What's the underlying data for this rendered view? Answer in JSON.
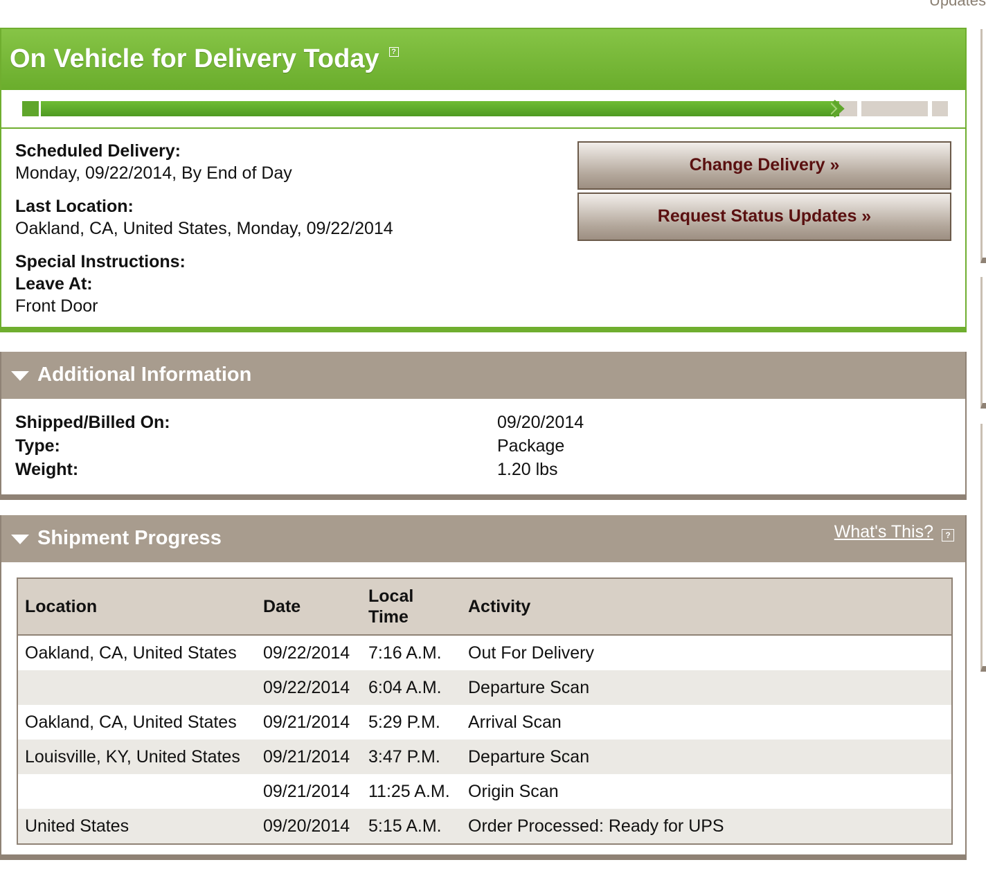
{
  "top_cut_text": "Updates",
  "status": {
    "title": "On Vehicle for Delivery Today",
    "help_icon": "?",
    "progress_fraction": 0.88,
    "scheduled_delivery_label": "Scheduled Delivery:",
    "scheduled_delivery_value": "Monday, 09/22/2014, By End of Day",
    "last_location_label": "Last Location:",
    "last_location_value": "Oakland, CA, United States, Monday, 09/22/2014",
    "special_instructions_label": "Special Instructions:",
    "leave_at_label": "Leave At:",
    "leave_at_value": "Front Door",
    "buttons": {
      "change_delivery": "Change Delivery »",
      "request_updates": "Request Status Updates »"
    },
    "colors": {
      "accent_green": "#6fae2f",
      "button_text": "#5a1010"
    }
  },
  "additional_info": {
    "title": "Additional Information",
    "rows": [
      {
        "label": "Shipped/Billed On:",
        "value": "09/20/2014"
      },
      {
        "label": "Type:",
        "value": "Package"
      },
      {
        "label": "Weight:",
        "value": "1.20 lbs"
      }
    ]
  },
  "shipment_progress": {
    "title": "Shipment Progress",
    "whats_this": "What's This?",
    "help_icon": "?",
    "columns": [
      "Location",
      "Date",
      "Local Time",
      "Activity"
    ],
    "rows": [
      {
        "location": "Oakland, CA, United States",
        "date": "09/22/2014",
        "time": "7:16 A.M.",
        "activity": "Out For Delivery"
      },
      {
        "location": "",
        "date": "09/22/2014",
        "time": "6:04 A.M.",
        "activity": "Departure Scan"
      },
      {
        "location": "Oakland, CA, United States",
        "date": "09/21/2014",
        "time": "5:29 P.M.",
        "activity": "Arrival Scan"
      },
      {
        "location": "Louisville, KY, United States",
        "date": "09/21/2014",
        "time": "3:47 P.M.",
        "activity": "Departure Scan"
      },
      {
        "location": "",
        "date": "09/21/2014",
        "time": "11:25 A.M.",
        "activity": "Origin Scan"
      },
      {
        "location": "United States",
        "date": "09/20/2014",
        "time": "5:15 A.M.",
        "activity": "Order Processed: Ready for UPS"
      }
    ]
  }
}
